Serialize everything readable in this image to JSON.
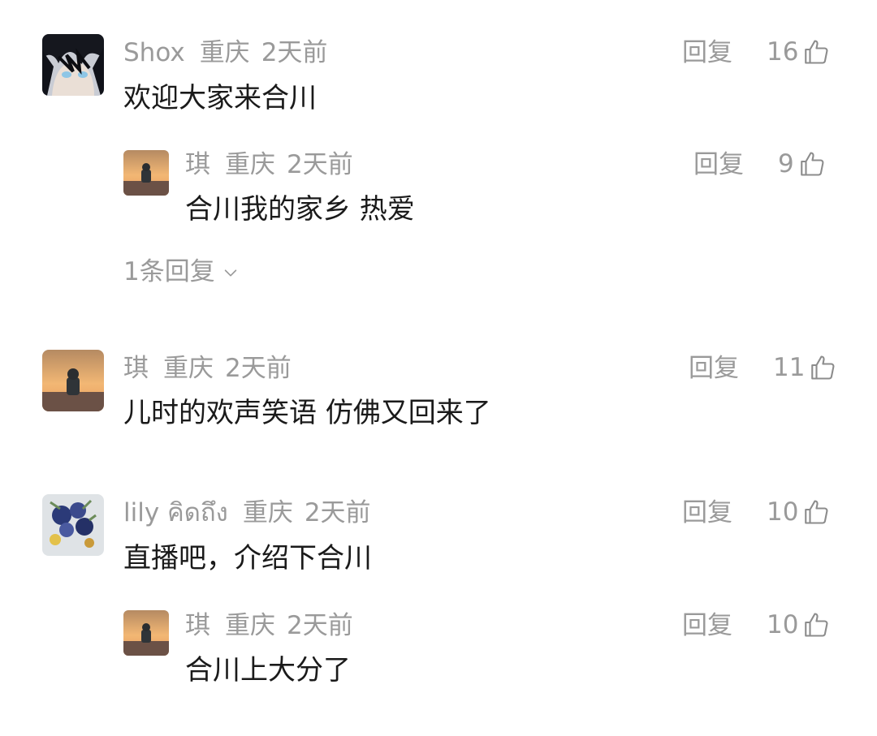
{
  "comments": [
    {
      "username": "Shox",
      "location": "重庆",
      "time": "2天前",
      "text": "欢迎大家来合川",
      "reply_label": "回复",
      "likes": "16",
      "avatar": "anime-avatar",
      "replies": [
        {
          "username": "琪",
          "location": "重庆",
          "time": "2天前",
          "text": "合川我的家乡 热爱",
          "reply_label": "回复",
          "likes": "9",
          "avatar": "sunset-avatar"
        }
      ],
      "more_replies_label": "1条回复",
      "more_replies_icon": "chevron-down-icon"
    },
    {
      "username": "琪",
      "location": "重庆",
      "time": "2天前",
      "text": "儿时的欢声笑语 仿佛又回来了",
      "reply_label": "回复",
      "likes": "11",
      "avatar": "sunset-avatar"
    },
    {
      "username": "lily  คิดถึง",
      "location": "重庆",
      "time": "2天前",
      "text": "直播吧，介绍下合川",
      "reply_label": "回复",
      "likes": "10",
      "avatar": "flowers-avatar",
      "replies": [
        {
          "username": "琪",
          "location": "重庆",
          "time": "2天前",
          "text": "合川上大分了",
          "reply_label": "回复",
          "likes": "10",
          "avatar": "sunset-avatar"
        }
      ]
    }
  ],
  "icons": {
    "like": "thumbs-up-icon",
    "expand": "chevron-down-icon"
  },
  "colors": {
    "meta_text": "#9a9a9a",
    "body_text": "#1a1a1a",
    "background": "#ffffff"
  }
}
